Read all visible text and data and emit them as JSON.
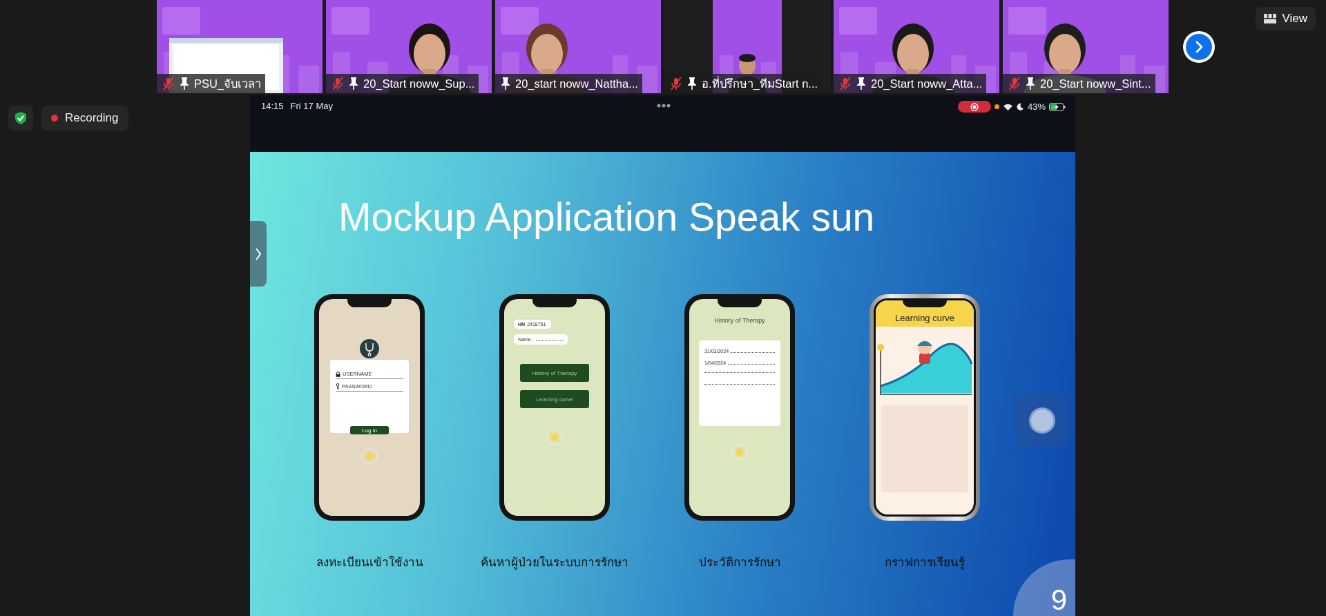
{
  "participants": [
    {
      "name": "PSU_จับเวลา",
      "kind": "timer",
      "muted": true,
      "pinned": true
    },
    {
      "name": "20_Start noww_Sup...",
      "kind": "camera",
      "muted": true,
      "pinned": true
    },
    {
      "name": "20_start noww_Nattha...",
      "kind": "camera",
      "muted": false,
      "pinned": true
    },
    {
      "name": "อ.ที่ปรึกษา_ทีมStart n...",
      "kind": "portrait",
      "muted": true,
      "pinned": true
    },
    {
      "name": "20_Start noww_Atta...",
      "kind": "camera",
      "muted": true,
      "pinned": true
    },
    {
      "name": "20_Start noww_Sint...",
      "kind": "camera",
      "muted": true,
      "pinned": true
    }
  ],
  "view_button": {
    "label": "View"
  },
  "recording": {
    "label": "Recording"
  },
  "shared_screen": {
    "status_bar": {
      "time": "14:15",
      "date": "Fri 17 May",
      "battery": "43%"
    },
    "slide": {
      "title": "Mockup Application Speak sun",
      "page_number": "9",
      "screens": [
        {
          "kind": "login",
          "username": "USERNAME",
          "password": "PASSWORD",
          "button": "Log in",
          "caption": "ลงทะเบียนเข้าใช้งาน"
        },
        {
          "kind": "search",
          "hn_label": "HN",
          "hn_value": "2418751",
          "name_label": "Name :",
          "buttons": [
            "History of Therapy",
            "Learning curve"
          ],
          "caption": "ค้นหาผู้ป่วยในระบบการรักษา"
        },
        {
          "kind": "history",
          "title": "History of Therapy",
          "entries": [
            "31/03/2024",
            "1/04/2024"
          ],
          "caption": "ประวัติการรักษา"
        },
        {
          "kind": "chart",
          "title": "Learning curve",
          "caption": "กราฟการเรียนรู้"
        }
      ]
    }
  }
}
